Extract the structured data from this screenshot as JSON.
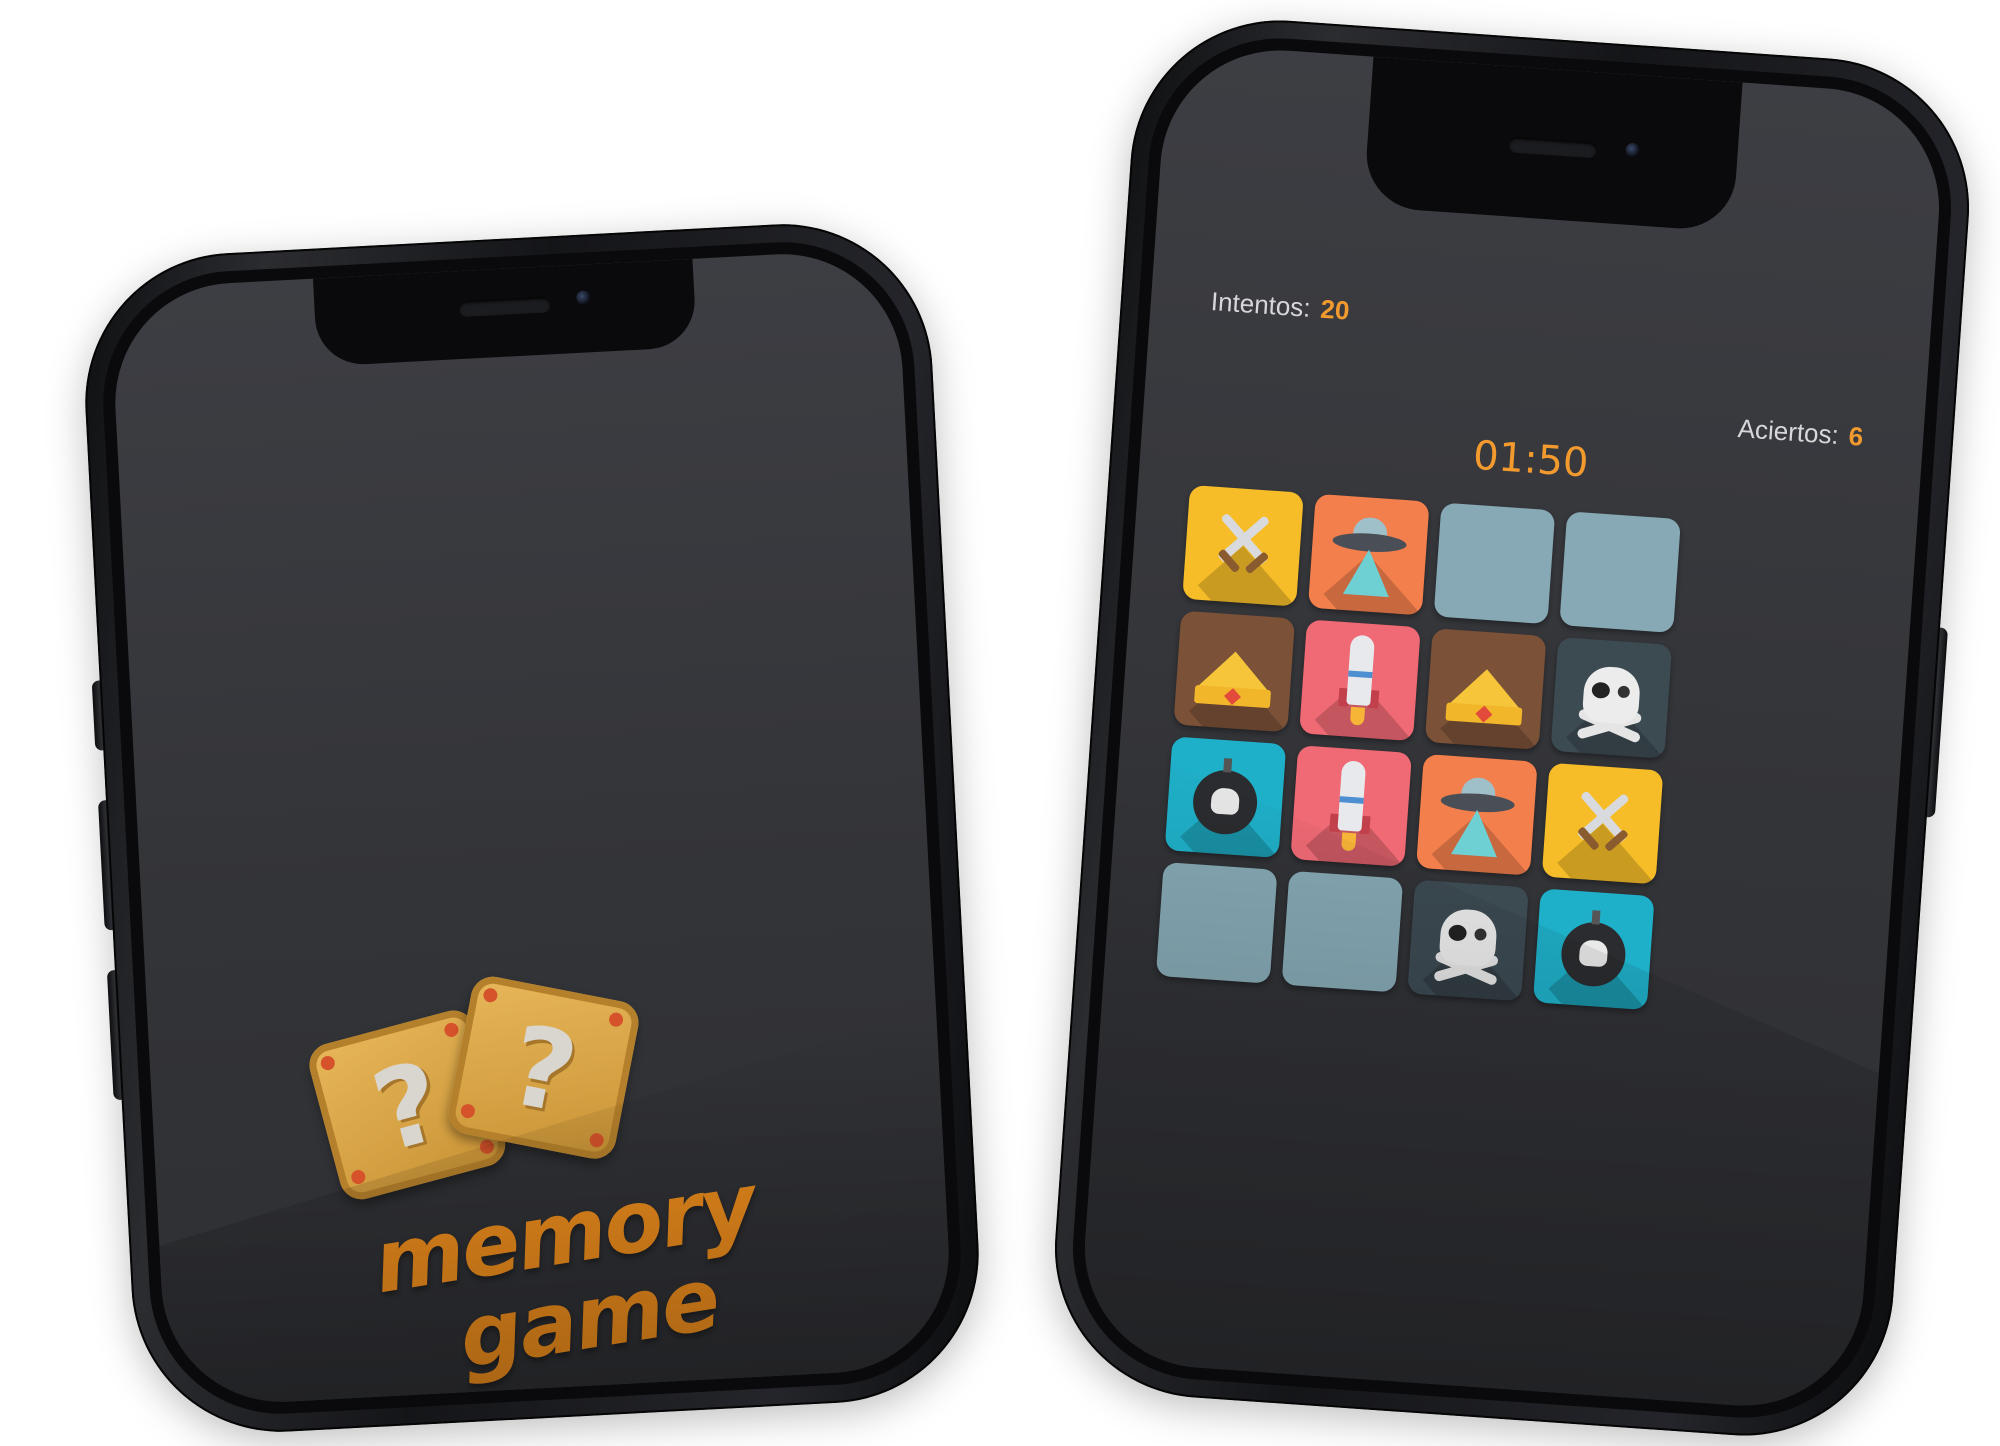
{
  "phone_left": {
    "logo": {
      "die_glyph": "?",
      "line1": "memory",
      "line2": "game",
      "color": "#ec8c1c"
    }
  },
  "phone_right": {
    "stats": {
      "intentos_label": "Intentos:",
      "intentos_value": "20",
      "aciertos_label": "Aciertos:",
      "aciertos_value": "6"
    },
    "timer": "01:50",
    "accent_color": "#f29a2e",
    "cards": [
      {
        "state": "revealed",
        "icon": "crossed-swords-icon",
        "color": "yellow"
      },
      {
        "state": "revealed",
        "icon": "ufo-icon",
        "color": "orange"
      },
      {
        "state": "hidden"
      },
      {
        "state": "hidden"
      },
      {
        "state": "revealed",
        "icon": "crown-icon",
        "color": "brown"
      },
      {
        "state": "revealed",
        "icon": "rocket-icon",
        "color": "pink"
      },
      {
        "state": "revealed",
        "icon": "crown-icon",
        "color": "brown"
      },
      {
        "state": "revealed",
        "icon": "pirate-skull-icon",
        "color": "slate"
      },
      {
        "state": "revealed",
        "icon": "skull-bomb-icon",
        "color": "teal"
      },
      {
        "state": "revealed",
        "icon": "rocket-icon",
        "color": "pink"
      },
      {
        "state": "revealed",
        "icon": "ufo-icon",
        "color": "orange"
      },
      {
        "state": "revealed",
        "icon": "crossed-swords-icon",
        "color": "yellow"
      },
      {
        "state": "hidden"
      },
      {
        "state": "hidden"
      },
      {
        "state": "revealed",
        "icon": "pirate-skull-icon",
        "color": "slate"
      },
      {
        "state": "revealed",
        "icon": "skull-bomb-icon",
        "color": "teal"
      }
    ]
  }
}
